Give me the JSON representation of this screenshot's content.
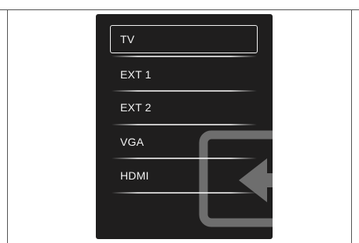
{
  "menu": {
    "items": [
      {
        "label": "TV",
        "selected": true
      },
      {
        "label": "EXT 1",
        "selected": false
      },
      {
        "label": "EXT 2",
        "selected": false
      },
      {
        "label": "VGA",
        "selected": false
      },
      {
        "label": "HDMI",
        "selected": false
      }
    ]
  },
  "icon": {
    "name": "input-source-icon"
  },
  "colors": {
    "panel_background": "#1f1e1e",
    "text": "#f2f2f2",
    "icon": "#6e6e6e"
  }
}
